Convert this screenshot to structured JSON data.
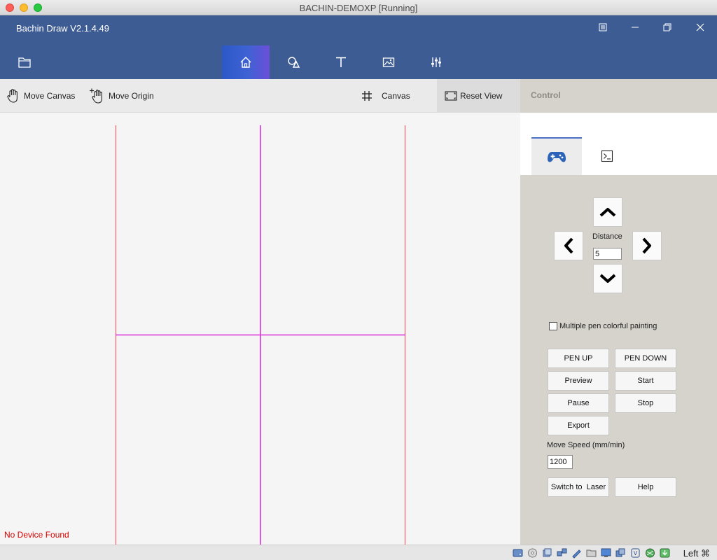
{
  "window": {
    "title": "BACHIN-DEMOXP [Running]"
  },
  "app": {
    "title": "Bachin Draw V2.1.4.49"
  },
  "header": {
    "window_buttons": [
      {
        "name": "menu-icon"
      },
      {
        "name": "minimize-icon"
      },
      {
        "name": "restore-icon"
      },
      {
        "name": "close-icon"
      }
    ],
    "tabs": [
      {
        "name": "home",
        "icon": "home-icon",
        "active": true
      },
      {
        "name": "shapes",
        "icon": "shapes-icon",
        "active": false
      },
      {
        "name": "text",
        "icon": "text-icon",
        "active": false
      },
      {
        "name": "image",
        "icon": "image-icon",
        "active": false
      },
      {
        "name": "settings",
        "icon": "sliders-icon",
        "active": false
      }
    ]
  },
  "toolbar": {
    "move_canvas": "Move Canvas",
    "move_origin": "Move Origin",
    "canvas": "Canvas",
    "reset_view": "Reset View"
  },
  "canvas": {
    "status": "No Device Found",
    "boundary_color": "#f0606a",
    "axis_color": "#d930d9"
  },
  "control": {
    "title": "Control",
    "tabs": [
      {
        "name": "gamepad",
        "icon": "gamepad-icon",
        "active": true
      },
      {
        "name": "terminal",
        "icon": "terminal-icon",
        "active": false
      }
    ],
    "distance_label": "Distance",
    "distance_value": "5",
    "multi_pen_label": "Multiple pen colorful painting",
    "multi_pen_checked": false,
    "buttons": {
      "pen_up": "PEN UP",
      "pen_down": "PEN DOWN",
      "preview": "Preview",
      "start": "Start",
      "pause": "Pause",
      "stop": "Stop",
      "export": "Export",
      "switch_laser": "Switch to  Laser",
      "help": "Help"
    },
    "speed_label": "Move Speed (mm/min)",
    "speed_value": "1200"
  },
  "statusbar": {
    "host_key": "Left ⌘"
  },
  "colors": {
    "header_bg": "#3e5c94",
    "active_tab": "#3e62d4",
    "panel_bg": "#d6d3cd",
    "status_error": "#dd0000"
  }
}
